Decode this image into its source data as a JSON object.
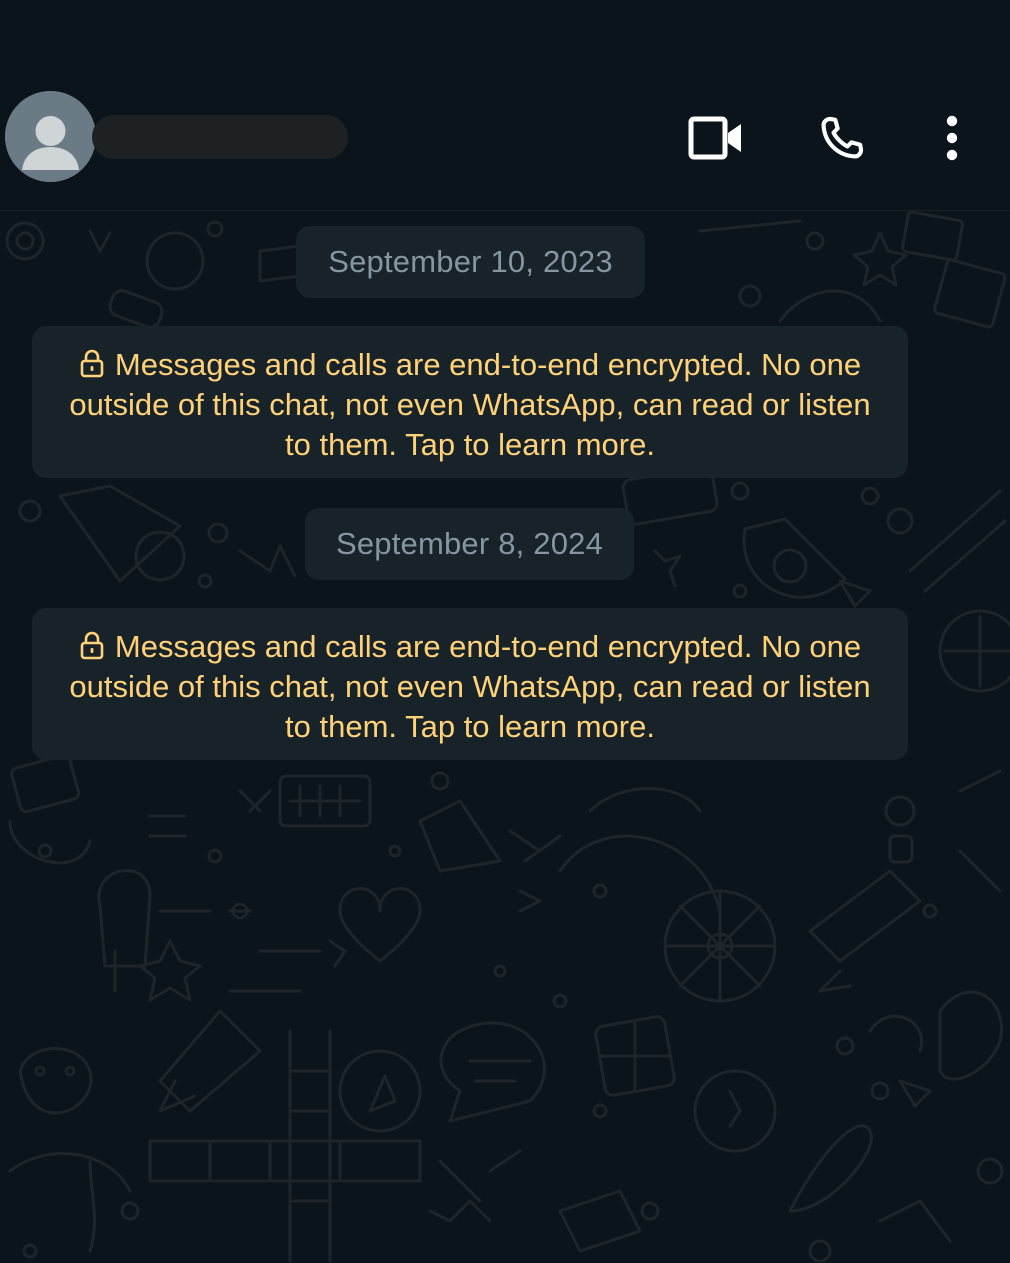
{
  "header": {
    "contact_name": "",
    "video_call_icon": "video-camera-icon",
    "voice_call_icon": "phone-icon",
    "menu_icon": "more-vertical-icon"
  },
  "chat": {
    "messages": [
      {
        "date": "September 10, 2023",
        "notice": "Messages and calls are end-to-end encrypted. No one outside of this chat, not even WhatsApp, can read or listen to them. Tap to learn more."
      },
      {
        "date": "September 8, 2024",
        "notice": "Messages and calls are end-to-end encrypted. No one outside of this chat, not even WhatsApp, can read or listen to them. Tap to learn more."
      }
    ]
  },
  "colors": {
    "background": "#0b141a",
    "bubble": "#182229",
    "date_text": "#8696a0",
    "notice_text": "#ffd279",
    "icon": "#ffffff"
  }
}
